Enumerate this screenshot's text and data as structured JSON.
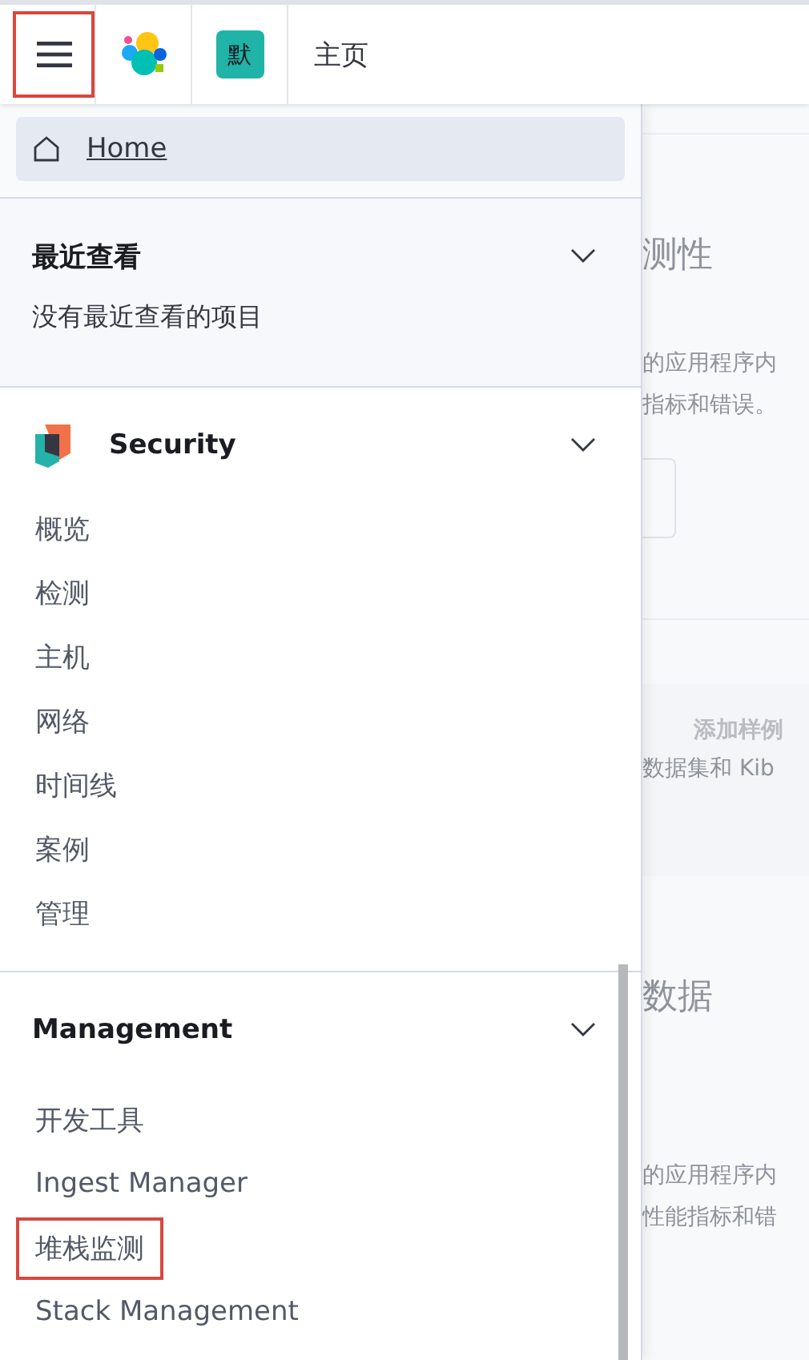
{
  "header": {
    "menu_highlighted": true,
    "space_badge": "默",
    "breadcrumb": "主页"
  },
  "nav": {
    "home": {
      "label": "Home",
      "selected": true
    },
    "sections": [
      {
        "kind": "recent",
        "title": "最近查看",
        "expanded": true,
        "empty_text": "没有最近查看的项目"
      },
      {
        "kind": "security",
        "title": "Security",
        "expanded": true,
        "items": [
          {
            "label": "概览",
            "highlighted": false
          },
          {
            "label": "检测",
            "highlighted": false
          },
          {
            "label": "主机",
            "highlighted": false
          },
          {
            "label": "网络",
            "highlighted": false
          },
          {
            "label": "时间线",
            "highlighted": false
          },
          {
            "label": "案例",
            "highlighted": false
          },
          {
            "label": "管理",
            "highlighted": false
          }
        ]
      },
      {
        "kind": "management",
        "title": "Management",
        "expanded": true,
        "items": [
          {
            "label": "开发工具",
            "highlighted": false
          },
          {
            "label": "Ingest Manager",
            "highlighted": false
          },
          {
            "label": "堆栈监测",
            "highlighted": true
          },
          {
            "label": "Stack Management",
            "highlighted": false
          }
        ]
      }
    ]
  },
  "background": {
    "title_1": "测性",
    "desc_1a": "的应用程序内",
    "desc_1b": "指标和错误。",
    "sample_title": "添加样例",
    "sample_desc": "数据集和 Kib",
    "title_2": "数据",
    "desc_2a": "的应用程序内",
    "desc_2b": "性能指标和错"
  }
}
